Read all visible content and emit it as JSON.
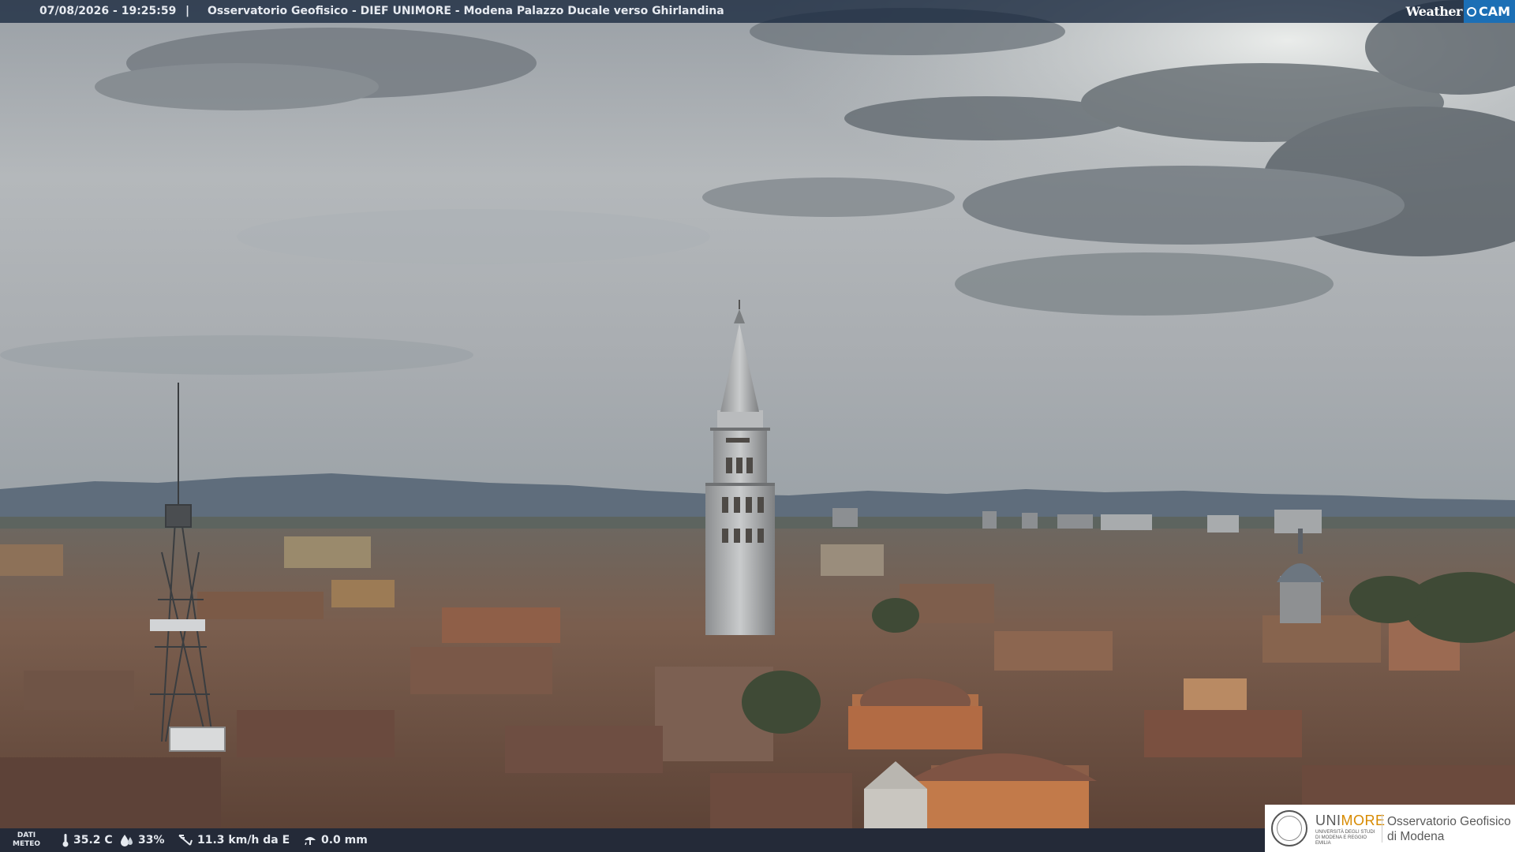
{
  "header": {
    "timestamp": "07/08/2026 - 19:25:59",
    "separator": "|",
    "title": "Osservatorio Geofisico - DIEF UNIMORE - Modena Palazzo Ducale verso Ghirlandina",
    "brand_weather": "Weather",
    "brand_cam": "CAM"
  },
  "weather": {
    "dati_line1": "DATI",
    "dati_line2": "METEO",
    "temperature": "35.2 C",
    "humidity": "33%",
    "wind": "11.3 km/h da E",
    "rain": "0.0 mm"
  },
  "logo": {
    "uni_a": "UNI",
    "uni_b": "MORE",
    "uni_sub": "UNIVERSITÀ DEGLI STUDI DI MODENA E REGGIO EMILIA",
    "obs_line1": "Osservatorio Geofisico",
    "obs_line2": "di Modena"
  },
  "colors": {
    "bar_bg": "#18283e",
    "brand_blue": "#1c6fb5",
    "unimore_orange": "#d78a00",
    "roof_terracotta": "#8a5a44"
  },
  "icons": [
    "thermometer-icon",
    "humidity-drop-icon",
    "wind-icon",
    "rain-gauge-icon"
  ]
}
